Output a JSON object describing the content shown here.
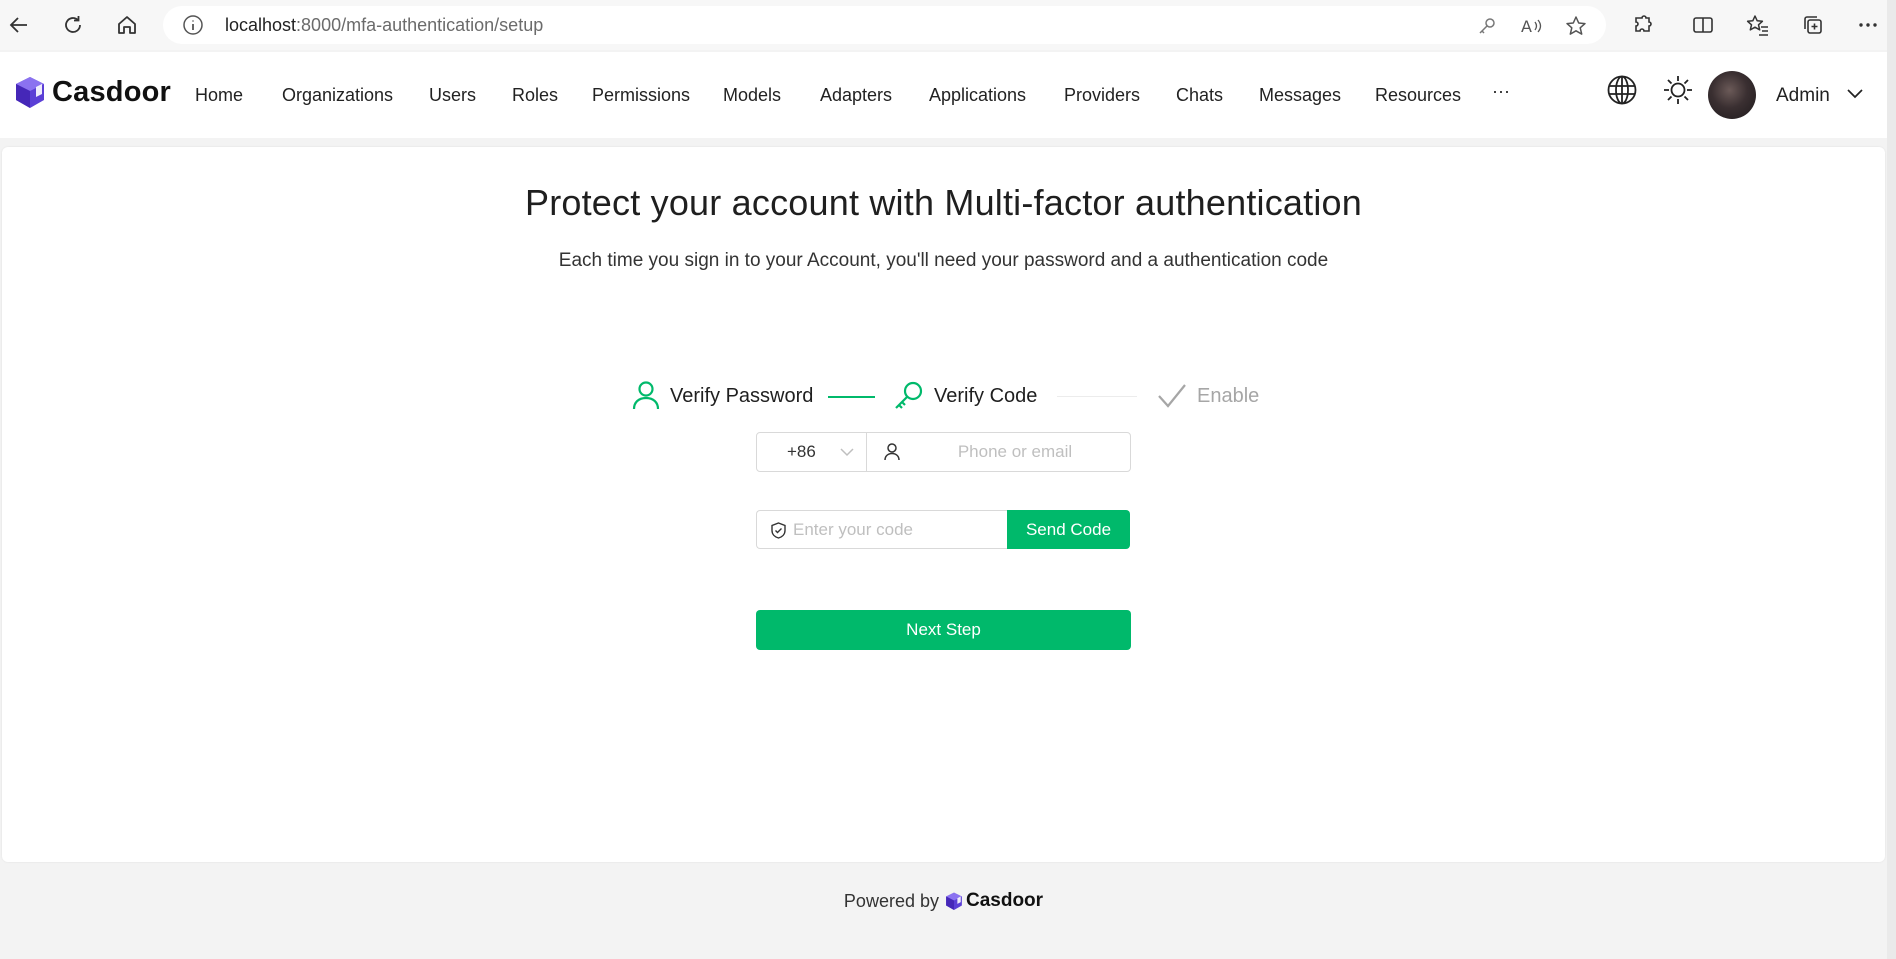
{
  "browser": {
    "url_host": "localhost",
    "url_path": ":8000/mfa-authentication/setup",
    "icons": [
      "back-icon",
      "refresh-icon",
      "home-icon",
      "info-icon",
      "key-icon",
      "read-aloud-icon",
      "star-icon",
      "extensions-icon",
      "split-screen-icon",
      "favorites-icon",
      "collections-icon",
      "more-icon"
    ]
  },
  "app": {
    "brand": "Casdoor",
    "nav": [
      "Home",
      "Organizations",
      "Users",
      "Roles",
      "Permissions",
      "Models",
      "Adapters",
      "Applications",
      "Providers",
      "Chats",
      "Messages",
      "Resources",
      "···"
    ],
    "user": "Admin"
  },
  "page": {
    "title": "Protect your account with Multi-factor authentication",
    "subtitle": "Each time you sign in to your Account, you'll need your password and a authentication code"
  },
  "steps": [
    {
      "label": "Verify Password",
      "status": "done"
    },
    {
      "label": "Verify Code",
      "status": "current"
    },
    {
      "label": "Enable",
      "status": "pending"
    }
  ],
  "form": {
    "country_code": "+86",
    "phone_placeholder": "Phone or email",
    "code_placeholder": "Enter your code",
    "send_code": "Send Code",
    "next_step": "Next Step"
  },
  "footer": {
    "powered_by": "Powered by",
    "brand": "Casdoor"
  },
  "colors": {
    "accent": "#00b96b",
    "pending": "#a6a6a6"
  }
}
